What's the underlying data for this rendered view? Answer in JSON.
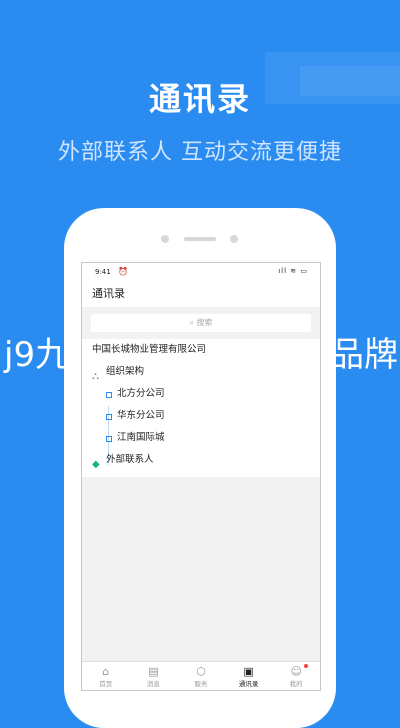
{
  "hero": {
    "title": "通讯录",
    "subtitle": "外部联系人 互动交流更便捷"
  },
  "status_bar": {
    "time": "9:41",
    "alarm_icon": "alarm-icon",
    "indicators": "ıll ≋ ▭"
  },
  "app": {
    "page_title": "通讯录",
    "search": {
      "icon": "search-icon",
      "placeholder": "搜索"
    },
    "company": "中国长城物业管理有限公司",
    "org": {
      "label": "组织架构",
      "icon": "org-tree-icon"
    },
    "branches": [
      "北方分公司",
      "华东分公司",
      "江南国际城"
    ],
    "external": {
      "label": "外部联系人",
      "icon": "contacts-icon"
    }
  },
  "tabs": [
    {
      "label": "首页",
      "icon": "home-icon"
    },
    {
      "label": "消息",
      "icon": "message-icon"
    },
    {
      "label": "服务",
      "icon": "box-icon"
    },
    {
      "label": "通讯录",
      "icon": "contacts-book-icon",
      "active": true
    },
    {
      "label": "我的",
      "icon": "smile-icon",
      "badge": true
    }
  ],
  "overlay": {
    "left": "j9九",
    "right": "品牌"
  },
  "colors": {
    "brand": "#2a8cf0",
    "badge": "#f5413a",
    "external_icon": "#16b37a"
  }
}
